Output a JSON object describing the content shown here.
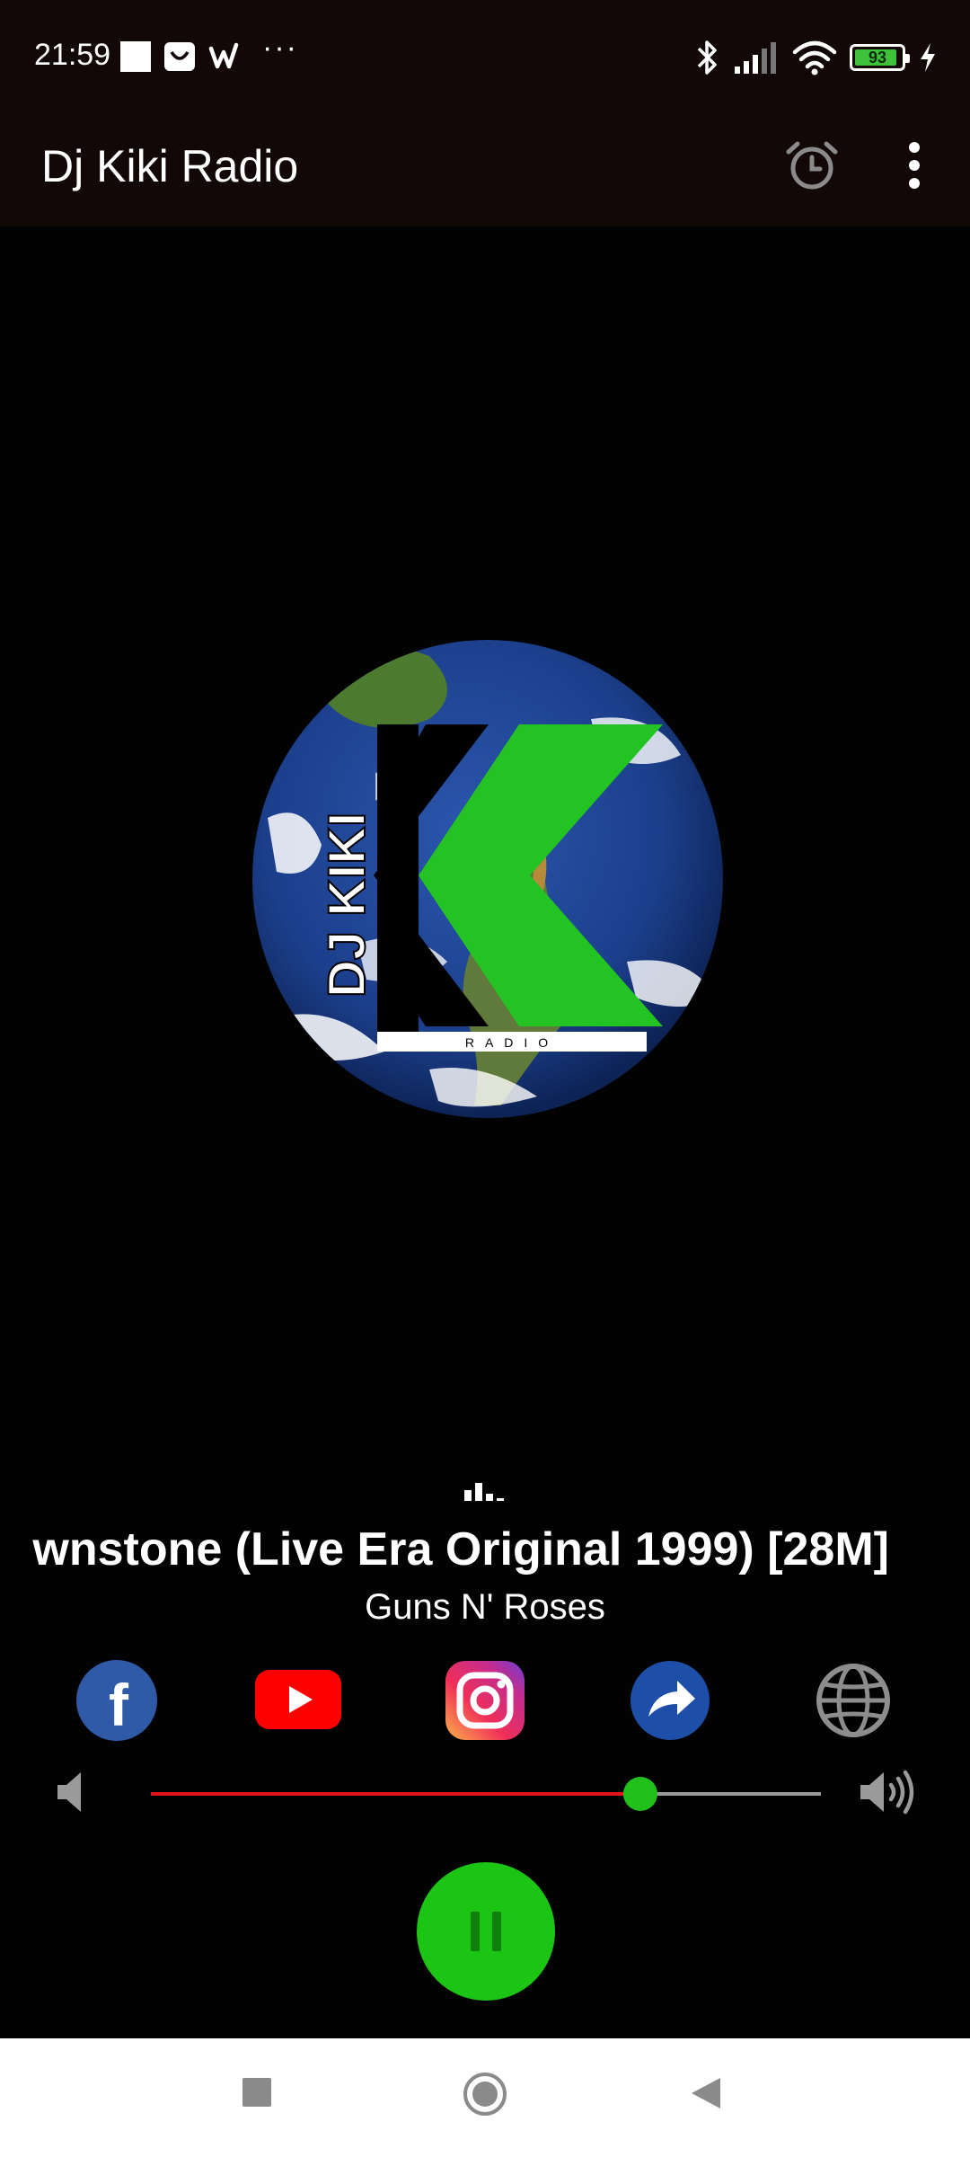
{
  "status_bar": {
    "time": "21:59",
    "more": "···",
    "battery_level": "93"
  },
  "app_bar": {
    "title": "Dj Kiki Radio",
    "alarm_icon": "alarm-clock-icon",
    "menu_icon": "more-vert-icon"
  },
  "logo": {
    "text_side": "DJ KIKI",
    "text_bottom": "RADIO",
    "colors": {
      "green": "#22c322",
      "ocean": "#1c3f8c"
    }
  },
  "now_playing": {
    "title": "wnstone (Live Era Original 1999) [28M]",
    "artist": "Guns N' Roses"
  },
  "social": [
    {
      "name": "facebook",
      "icon": "facebook-icon",
      "glyph": "f"
    },
    {
      "name": "youtube",
      "icon": "youtube-icon"
    },
    {
      "name": "instagram",
      "icon": "instagram-icon"
    },
    {
      "name": "share",
      "icon": "share-icon"
    },
    {
      "name": "website",
      "icon": "globe-icon"
    }
  ],
  "volume": {
    "level": 0.73,
    "fill_color": "#e0151e",
    "thumb_color": "#1fc11a"
  },
  "player": {
    "state": "playing",
    "button_icon": "pause-icon",
    "button_color": "#1cc414"
  },
  "nav_bar": {
    "icons": [
      "recents-square-icon",
      "home-circle-icon",
      "back-triangle-icon"
    ]
  }
}
